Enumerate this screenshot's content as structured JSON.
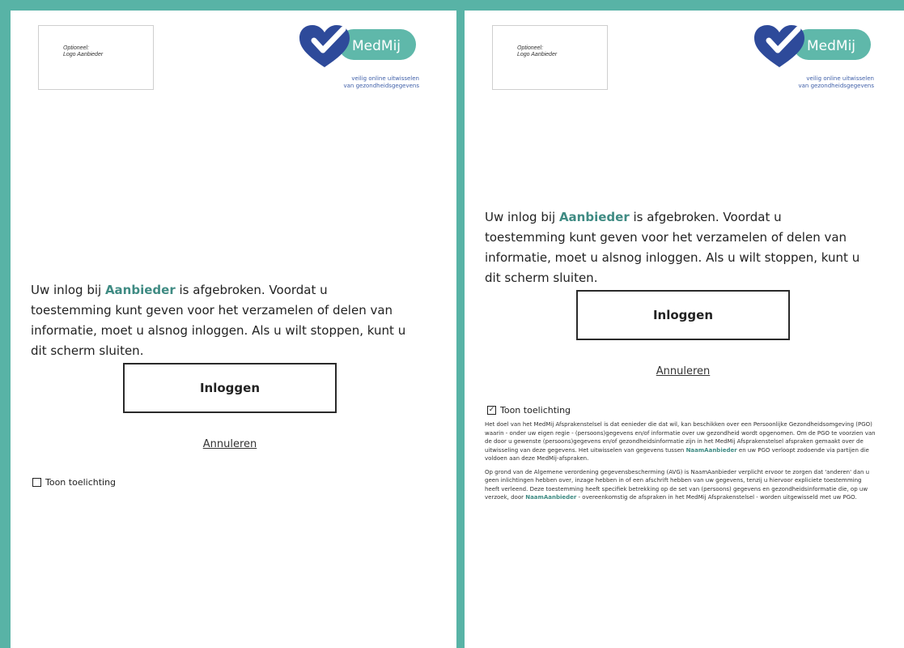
{
  "logo_placeholder": {
    "line1": "Optioneel:",
    "line2": "Logo Aanbieder"
  },
  "medmij": {
    "wordmark": "MedMij",
    "tagline1": "veilig online uitwisselen",
    "tagline2": "van gezondheidsgegevens",
    "teal": "#5fb8aa",
    "navy": "#2e4a9a"
  },
  "message": {
    "pre": "Uw inlog bij ",
    "provider": "Aanbieder",
    "post": " is afgebroken. Voordat u toestemming kunt geven voor het verzamelen of delen van informatie, moet u alsnog inloggen. Als u wilt stoppen, kunt u dit scherm sluiten."
  },
  "login_button": "Inloggen",
  "cancel_link": "Annuleren",
  "toggle_label": "Toon toelichting",
  "panels": {
    "left": {
      "toggle_checked": false
    },
    "right": {
      "toggle_checked": true
    }
  },
  "explanation": {
    "p1_pre": "Het doel van het MedMij Afsprakenstelsel is dat eenieder die dat wil, kan beschikken over een Persoonlijke Gezondheidsomgeving (PGO) waarin - onder uw eigen regie - (persoons)gegevens en/of informatie over uw gezondheid wordt opgenomen. Om de PGO te voorzien van de door u gewenste (persoons)gegevens en/of gezondheidsinformatie zijn in het MedMij Afsprakenstelsel afspraken gemaakt over de uitwisseling van deze gegevens. Het uitwisselen van gegevens tussen ",
    "p1_name": "NaamAanbieder",
    "p1_post": " en uw PGO verloopt zodoende via partijen die voldoen aan deze MedMij-afspraken.",
    "p2_pre": "Op grond van de Algemene verordening gegevensbescherming (AVG) is NaamAanbieder verplicht ervoor te zorgen dat 'anderen' dan u geen inlichtingen hebben over, inzage hebben in of een afschrift hebben van uw gegevens, tenzij u hiervoor expliciete toestemming heeft verleend. Deze toestemming heeft specifiek betrekking op de set van (persoons) gegevens en gezondheidsinformatie die, op uw verzoek, door ",
    "p2_name": "NaamAanbieder",
    "p2_post": " - overeenkomstig de afspraken in het MedMij Afsprakenstelsel - worden uitgewisseld met uw PGO."
  }
}
